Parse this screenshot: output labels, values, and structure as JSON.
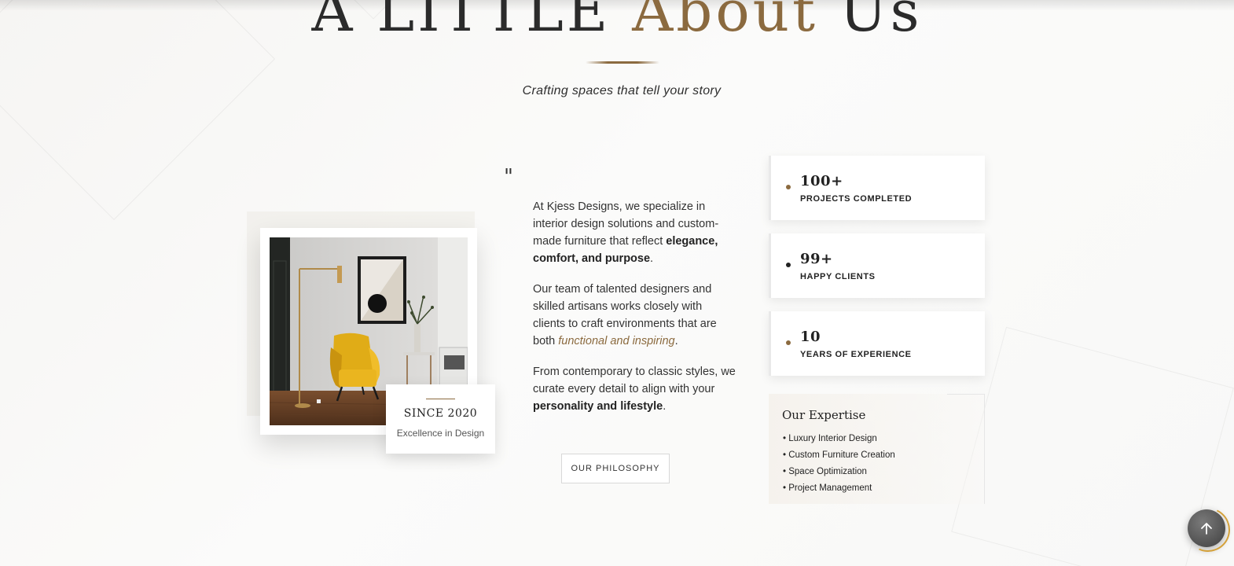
{
  "header": {
    "title_part1": "A LITTLE",
    "title_part2": "About",
    "title_part3": "Us",
    "subtitle": "Crafting spaces that tell your story"
  },
  "image_card": {
    "badge_title": "SINCE 2020",
    "badge_subtitle": "Excellence in Design"
  },
  "about": {
    "quote_mark": "\"",
    "p1_a": "At Kjess Designs, we specialize in interior design solutions and custom-made furniture that reflect ",
    "p1_b": "elegance, comfort, and purpose",
    "p1_c": ".",
    "p2_a": "Our team of talented designers and skilled artisans works closely with clients to craft environments that are both ",
    "p2_b": "functional and inspiring",
    "p2_c": ".",
    "p3_a": "From contemporary to classic styles, we curate every detail to align with your ",
    "p3_b": "personality and lifestyle",
    "p3_c": ".",
    "button_label": "OUR PHILOSOPHY"
  },
  "stats": [
    {
      "value": "100+",
      "label": "PROJECTS COMPLETED",
      "dot_color": "#8b6a3f"
    },
    {
      "value": "99+",
      "label": "HAPPY CLIENTS",
      "dot_color": "#222222"
    },
    {
      "value": "10",
      "label": "YEARS OF EXPERIENCE",
      "dot_color": "#8b6a3f"
    }
  ],
  "expertise": {
    "title": "Our Expertise",
    "items": [
      "Luxury Interior Design",
      "Custom Furniture Creation",
      "Space Optimization",
      "Project Management"
    ]
  },
  "colors": {
    "accent": "#8b6a3f",
    "text": "#222222"
  },
  "icons": {
    "scroll_top": "arrow-up-icon"
  }
}
